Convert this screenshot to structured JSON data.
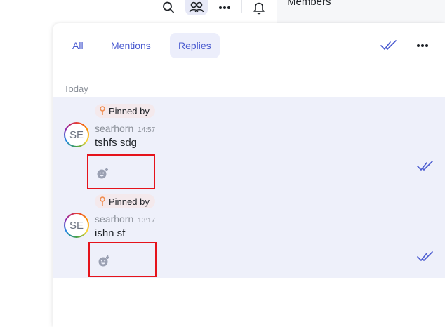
{
  "topbar": {
    "icons": [
      "search-icon",
      "members-icon",
      "more-horizontal-icon",
      "bell-icon"
    ],
    "members_label": "Members"
  },
  "tabs": [
    {
      "label": "All",
      "active": false
    },
    {
      "label": "Mentions",
      "active": false
    },
    {
      "label": "Replies",
      "active": true
    }
  ],
  "panel_icons": [
    "double-check-icon",
    "more-horizontal-icon"
  ],
  "day_label": "Today",
  "messages": [
    {
      "pinned_label": "Pinned by",
      "avatar_initials": "SE",
      "author": "searhorn",
      "time": "14:57",
      "text": "tshfs sdg",
      "reaction_icon": "add-reaction-icon",
      "read_icon": "double-check-icon"
    },
    {
      "pinned_label": "Pinned by",
      "avatar_initials": "SE",
      "author": "searhorn",
      "time": "13:17",
      "text": "ishn sf",
      "reaction_icon": "add-reaction-icon",
      "read_icon": "double-check-icon"
    }
  ],
  "colors": {
    "accent": "#4a5bd0",
    "highlight_bg": "#eef0fa",
    "pinned_bg": "#f4e9ec",
    "annotation_red": "#e5131b"
  }
}
